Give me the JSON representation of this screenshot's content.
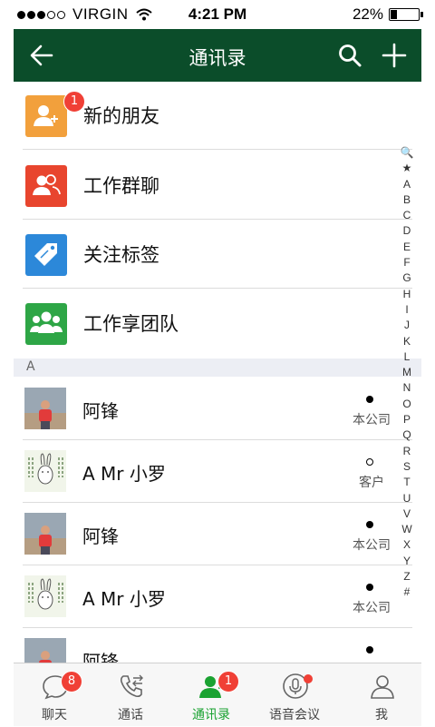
{
  "status_bar": {
    "carrier": "●●●○○ VIRGIN",
    "carrier_name": "VIRGIN",
    "time": "4:21 PM",
    "battery": "22%",
    "battery_level": 0.22
  },
  "header": {
    "title": "通讯录"
  },
  "menu": [
    {
      "label": "新的朋友",
      "icon": "new-friend-icon",
      "color": "#f2a03c",
      "badge": "1"
    },
    {
      "label": "工作群聊",
      "icon": "group-chat-icon",
      "color": "#e8452e"
    },
    {
      "label": "关注标签",
      "icon": "tag-icon",
      "color": "#2c88d9"
    },
    {
      "label": "工作享团队",
      "icon": "team-icon",
      "color": "#2ea646"
    }
  ],
  "section_letter": "A",
  "contacts": [
    {
      "name": "阿锋",
      "tag": "本公司",
      "avatar": "photo-avatar"
    },
    {
      "name": "A Mr   小罗",
      "tag": "客户",
      "avatar": "rabbit-avatar"
    },
    {
      "name": "阿锋",
      "tag": "本公司",
      "avatar": "photo-avatar"
    },
    {
      "name": "A Mr   小罗",
      "tag": "本公司",
      "avatar": "rabbit-avatar"
    },
    {
      "name": "阿锋",
      "tag": "",
      "avatar": "photo-avatar"
    }
  ],
  "index": [
    "🔍",
    "★",
    "A",
    "B",
    "C",
    "D",
    "E",
    "F",
    "G",
    "H",
    "I",
    "J",
    "K",
    "L",
    "M",
    "N",
    "O",
    "P",
    "Q",
    "R",
    "S",
    "T",
    "U",
    "V",
    "W",
    "X",
    "Y",
    "Z",
    "#"
  ],
  "tabs": [
    {
      "label": "聊天",
      "badge": "8"
    },
    {
      "label": "通话"
    },
    {
      "label": "通讯录",
      "badge": "1",
      "active": true
    },
    {
      "label": "语音会议",
      "dot": true
    },
    {
      "label": "我"
    }
  ],
  "colors": {
    "header": "#0b4d2a",
    "active_tab": "#1aa231",
    "badge": "#f04036"
  }
}
